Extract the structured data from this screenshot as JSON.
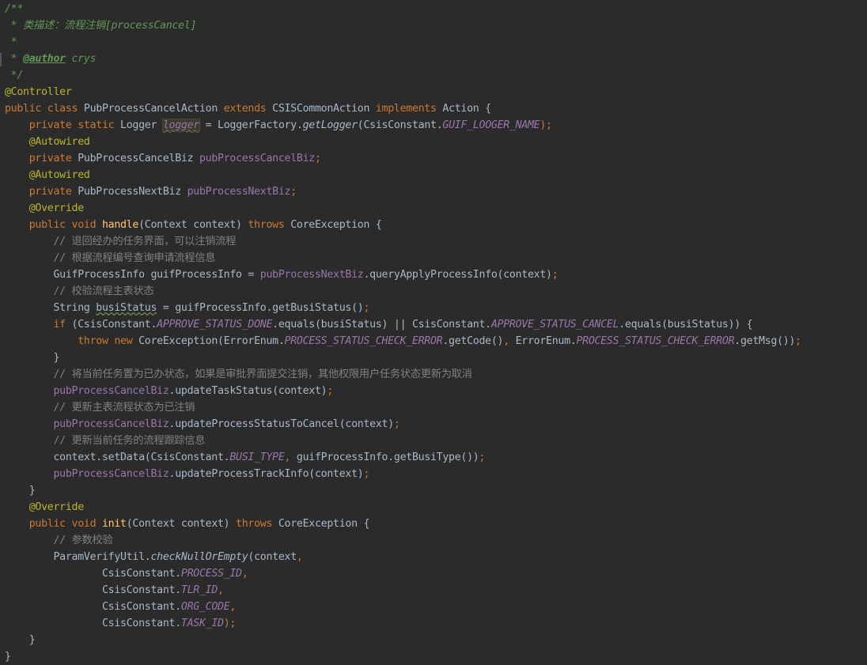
{
  "editor": {
    "language": "java",
    "theme": "darcula",
    "colors": {
      "background": "#2b2b2b",
      "keyword": "#cc7832",
      "annotation": "#bbb529",
      "doc_comment": "#629755",
      "line_comment": "#808080",
      "field": "#9876aa",
      "method_declaration": "#ffc66d",
      "default_text": "#a9b7c6"
    },
    "lines": [
      {
        "tokens": [
          {
            "t": "/**",
            "c": "doc"
          }
        ]
      },
      {
        "tokens": [
          {
            "t": " * 类描述：流程注销[processCancel]",
            "c": "doc"
          }
        ]
      },
      {
        "tokens": [
          {
            "t": " *",
            "c": "doc"
          }
        ]
      },
      {
        "tokens": [
          {
            "t": " * ",
            "c": "doc"
          },
          {
            "t": "@author",
            "c": "doctag"
          },
          {
            "t": " crys",
            "c": "doc"
          }
        ]
      },
      {
        "tokens": [
          {
            "t": " */",
            "c": "doc"
          }
        ]
      },
      {
        "tokens": [
          {
            "t": "@Controller",
            "c": "ann"
          }
        ]
      },
      {
        "tokens": [
          {
            "t": "public class ",
            "c": "kw"
          },
          {
            "t": "PubProcessCancelAction ",
            "c": "plain"
          },
          {
            "t": "extends ",
            "c": "kw"
          },
          {
            "t": "CSISCommonAction ",
            "c": "plain"
          },
          {
            "t": "implements ",
            "c": "kw"
          },
          {
            "t": "Action {",
            "c": "plain"
          }
        ]
      },
      {
        "tokens": [
          {
            "t": "    private static ",
            "c": "kw"
          },
          {
            "t": "Logger ",
            "c": "plain"
          },
          {
            "t": "logger",
            "c": "hl"
          },
          {
            "t": " = LoggerFactory.",
            "c": "plain"
          },
          {
            "t": "getLogger",
            "c": "stat"
          },
          {
            "t": "(CsisConstant.",
            "c": "plain"
          },
          {
            "t": "GUIF_LOOGER_NAME",
            "c": "const"
          },
          {
            "t": ");",
            "c": "kw"
          }
        ]
      },
      {
        "tokens": [
          {
            "t": "    @Autowired",
            "c": "ann"
          }
        ]
      },
      {
        "tokens": [
          {
            "t": "    private ",
            "c": "kw"
          },
          {
            "t": "PubProcessCancelBiz ",
            "c": "plain"
          },
          {
            "t": "pubProcessCancelBiz",
            "c": "fld"
          },
          {
            "t": ";",
            "c": "kw"
          }
        ]
      },
      {
        "tokens": [
          {
            "t": "    @Autowired",
            "c": "ann"
          }
        ]
      },
      {
        "tokens": [
          {
            "t": "    private ",
            "c": "kw"
          },
          {
            "t": "PubProcessNextBiz ",
            "c": "plain"
          },
          {
            "t": "pubProcessNextBiz",
            "c": "fld"
          },
          {
            "t": ";",
            "c": "kw"
          }
        ]
      },
      {
        "tokens": [
          {
            "t": "    @Override",
            "c": "ann"
          }
        ]
      },
      {
        "tokens": [
          {
            "t": "    public void ",
            "c": "kw"
          },
          {
            "t": "handle",
            "c": "fn"
          },
          {
            "t": "(Context context) ",
            "c": "plain"
          },
          {
            "t": "throws ",
            "c": "kw"
          },
          {
            "t": "CoreException {",
            "c": "plain"
          }
        ]
      },
      {
        "tokens": [
          {
            "t": "        // 退回经办的任务界面，可以注销流程",
            "c": "cmt"
          }
        ]
      },
      {
        "tokens": [
          {
            "t": "        // 根据流程编号查询申请流程信息",
            "c": "cmt"
          }
        ]
      },
      {
        "tokens": [
          {
            "t": "        GuifProcessInfo guifProcessInfo = ",
            "c": "plain"
          },
          {
            "t": "pubProcessNextBiz",
            "c": "fld"
          },
          {
            "t": ".queryApplyProcessInfo(context)",
            "c": "plain"
          },
          {
            "t": ";",
            "c": "kw"
          }
        ]
      },
      {
        "tokens": [
          {
            "t": "        // 校验流程主表状态",
            "c": "cmt"
          }
        ]
      },
      {
        "tokens": [
          {
            "t": "        String ",
            "c": "plain"
          },
          {
            "t": "busiStatus",
            "c": "typo"
          },
          {
            "t": " = guifProcessInfo.getBusiStatus()",
            "c": "plain"
          },
          {
            "t": ";",
            "c": "kw"
          }
        ]
      },
      {
        "tokens": [
          {
            "t": "        if ",
            "c": "kw"
          },
          {
            "t": "(CsisConstant.",
            "c": "plain"
          },
          {
            "t": "APPROVE_STATUS_DONE",
            "c": "const"
          },
          {
            "t": ".equals(busiStatus) || CsisConstant.",
            "c": "plain"
          },
          {
            "t": "APPROVE_STATUS_CANCEL",
            "c": "const"
          },
          {
            "t": ".equals(busiStatus)) {",
            "c": "plain"
          }
        ]
      },
      {
        "tokens": [
          {
            "t": "            throw new ",
            "c": "kw"
          },
          {
            "t": "CoreException(ErrorEnum.",
            "c": "plain"
          },
          {
            "t": "PROCESS_STATUS_CHECK_ERROR",
            "c": "const"
          },
          {
            "t": ".getCode()",
            "c": "plain"
          },
          {
            "t": ", ",
            "c": "kw"
          },
          {
            "t": "ErrorEnum.",
            "c": "plain"
          },
          {
            "t": "PROCESS_STATUS_CHECK_ERROR",
            "c": "const"
          },
          {
            "t": ".getMsg())",
            "c": "plain"
          },
          {
            "t": ";",
            "c": "kw"
          }
        ]
      },
      {
        "tokens": [
          {
            "t": "        }",
            "c": "plain"
          }
        ]
      },
      {
        "tokens": [
          {
            "t": "        // 将当前任务置为已办状态，如果是审批界面提交注销，其他权限用户任务状态更新为取消",
            "c": "cmt"
          }
        ]
      },
      {
        "tokens": [
          {
            "t": "        ",
            "c": "plain"
          },
          {
            "t": "pubProcessCancelBiz",
            "c": "fld"
          },
          {
            "t": ".updateTaskStatus(context)",
            "c": "plain"
          },
          {
            "t": ";",
            "c": "kw"
          }
        ]
      },
      {
        "tokens": [
          {
            "t": "        // 更新主表流程状态为已注销",
            "c": "cmt"
          }
        ]
      },
      {
        "tokens": [
          {
            "t": "        ",
            "c": "plain"
          },
          {
            "t": "pubProcessCancelBiz",
            "c": "fld"
          },
          {
            "t": ".updateProcessStatusToCancel(context)",
            "c": "plain"
          },
          {
            "t": ";",
            "c": "kw"
          }
        ]
      },
      {
        "tokens": [
          {
            "t": "        // 更新当前任务的流程跟踪信息",
            "c": "cmt"
          }
        ]
      },
      {
        "tokens": [
          {
            "t": "        context.setData(CsisConstant.",
            "c": "plain"
          },
          {
            "t": "BUSI_TYPE",
            "c": "const"
          },
          {
            "t": ", ",
            "c": "kw"
          },
          {
            "t": "guifProcessInfo.getBusiType())",
            "c": "plain"
          },
          {
            "t": ";",
            "c": "kw"
          }
        ]
      },
      {
        "tokens": [
          {
            "t": "        ",
            "c": "plain"
          },
          {
            "t": "pubProcessCancelBiz",
            "c": "fld"
          },
          {
            "t": ".updateProcessTrackInfo(context)",
            "c": "plain"
          },
          {
            "t": ";",
            "c": "kw"
          }
        ]
      },
      {
        "tokens": [
          {
            "t": "    }",
            "c": "plain"
          }
        ]
      },
      {
        "tokens": [
          {
            "t": "    @Override",
            "c": "ann"
          }
        ]
      },
      {
        "tokens": [
          {
            "t": "    public void ",
            "c": "kw"
          },
          {
            "t": "init",
            "c": "fn"
          },
          {
            "t": "(Context context) ",
            "c": "plain"
          },
          {
            "t": "throws ",
            "c": "kw"
          },
          {
            "t": "CoreException {",
            "c": "plain"
          }
        ]
      },
      {
        "tokens": [
          {
            "t": "        // 参数校验",
            "c": "cmt"
          }
        ]
      },
      {
        "tokens": [
          {
            "t": "        ParamVerifyUtil.",
            "c": "plain"
          },
          {
            "t": "checkNullOrEmpty",
            "c": "stat"
          },
          {
            "t": "(context",
            "c": "plain"
          },
          {
            "t": ",",
            "c": "kw"
          }
        ]
      },
      {
        "tokens": [
          {
            "t": "                CsisConstant.",
            "c": "plain"
          },
          {
            "t": "PROCESS_ID",
            "c": "const"
          },
          {
            "t": ",",
            "c": "kw"
          }
        ]
      },
      {
        "tokens": [
          {
            "t": "                CsisConstant.",
            "c": "plain"
          },
          {
            "t": "TLR_ID",
            "c": "const"
          },
          {
            "t": ",",
            "c": "kw"
          }
        ]
      },
      {
        "tokens": [
          {
            "t": "                CsisConstant.",
            "c": "plain"
          },
          {
            "t": "ORG_CODE",
            "c": "const"
          },
          {
            "t": ",",
            "c": "kw"
          }
        ]
      },
      {
        "tokens": [
          {
            "t": "                CsisConstant.",
            "c": "plain"
          },
          {
            "t": "TASK_ID",
            "c": "const"
          },
          {
            "t": ");",
            "c": "kw"
          }
        ]
      },
      {
        "tokens": [
          {
            "t": "    }",
            "c": "plain"
          }
        ]
      },
      {
        "tokens": [
          {
            "t": "}",
            "c": "plain"
          }
        ]
      }
    ]
  }
}
